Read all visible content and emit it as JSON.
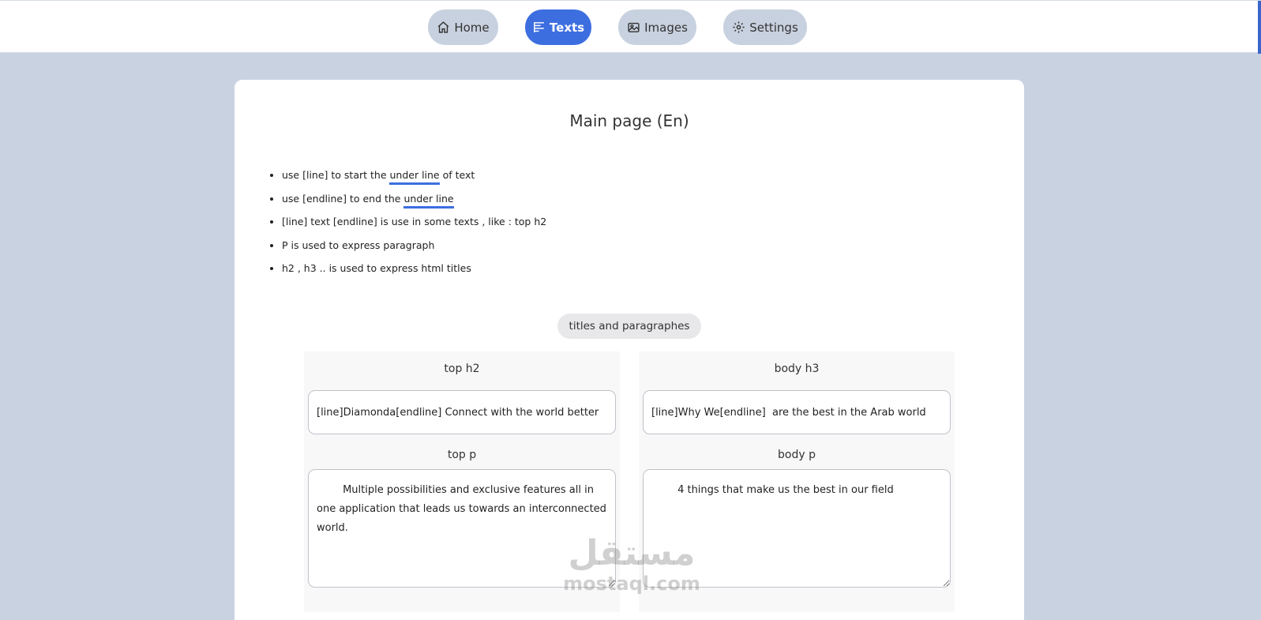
{
  "nav": {
    "home": "Home",
    "texts": "Texts",
    "images": "Images",
    "settings": "Settings"
  },
  "page": {
    "title": "Main page (En)"
  },
  "rules": [
    {
      "pre": "use [line] to start the ",
      "mark": "under line",
      "post": " of text"
    },
    {
      "pre": "use [endline] to end the ",
      "mark": "under line",
      "post": ""
    },
    {
      "pre": "[line] text [endline] is use in some texts , like : top h2",
      "mark": "",
      "post": ""
    },
    {
      "pre": "P is used to express paragraph",
      "mark": "",
      "post": ""
    },
    {
      "pre": "h2 , h3 .. is used to express html titles",
      "mark": "",
      "post": ""
    }
  ],
  "section": {
    "label": "titles and paragraphes"
  },
  "fields": {
    "top_h2": {
      "label": "top h2",
      "value": "[line]Diamonda[endline] Connect with the world better"
    },
    "top_p": {
      "label": "top p",
      "value": "        Multiple possibilities and exclusive features all in one application that leads us towards an interconnected world."
    },
    "body_h3": {
      "label": "body h3",
      "value": "[line]Why We[endline]  are the best in the Arab world"
    },
    "body_p": {
      "label": "body p",
      "value": "        4 things that make us the best in our field"
    }
  },
  "watermark": {
    "arabic": "مستقل",
    "latin": "mostaql.com"
  },
  "colors": {
    "accent": "#3d6ee0",
    "background": "#c9d2e1",
    "nav_inactive": "#c8d1df"
  }
}
